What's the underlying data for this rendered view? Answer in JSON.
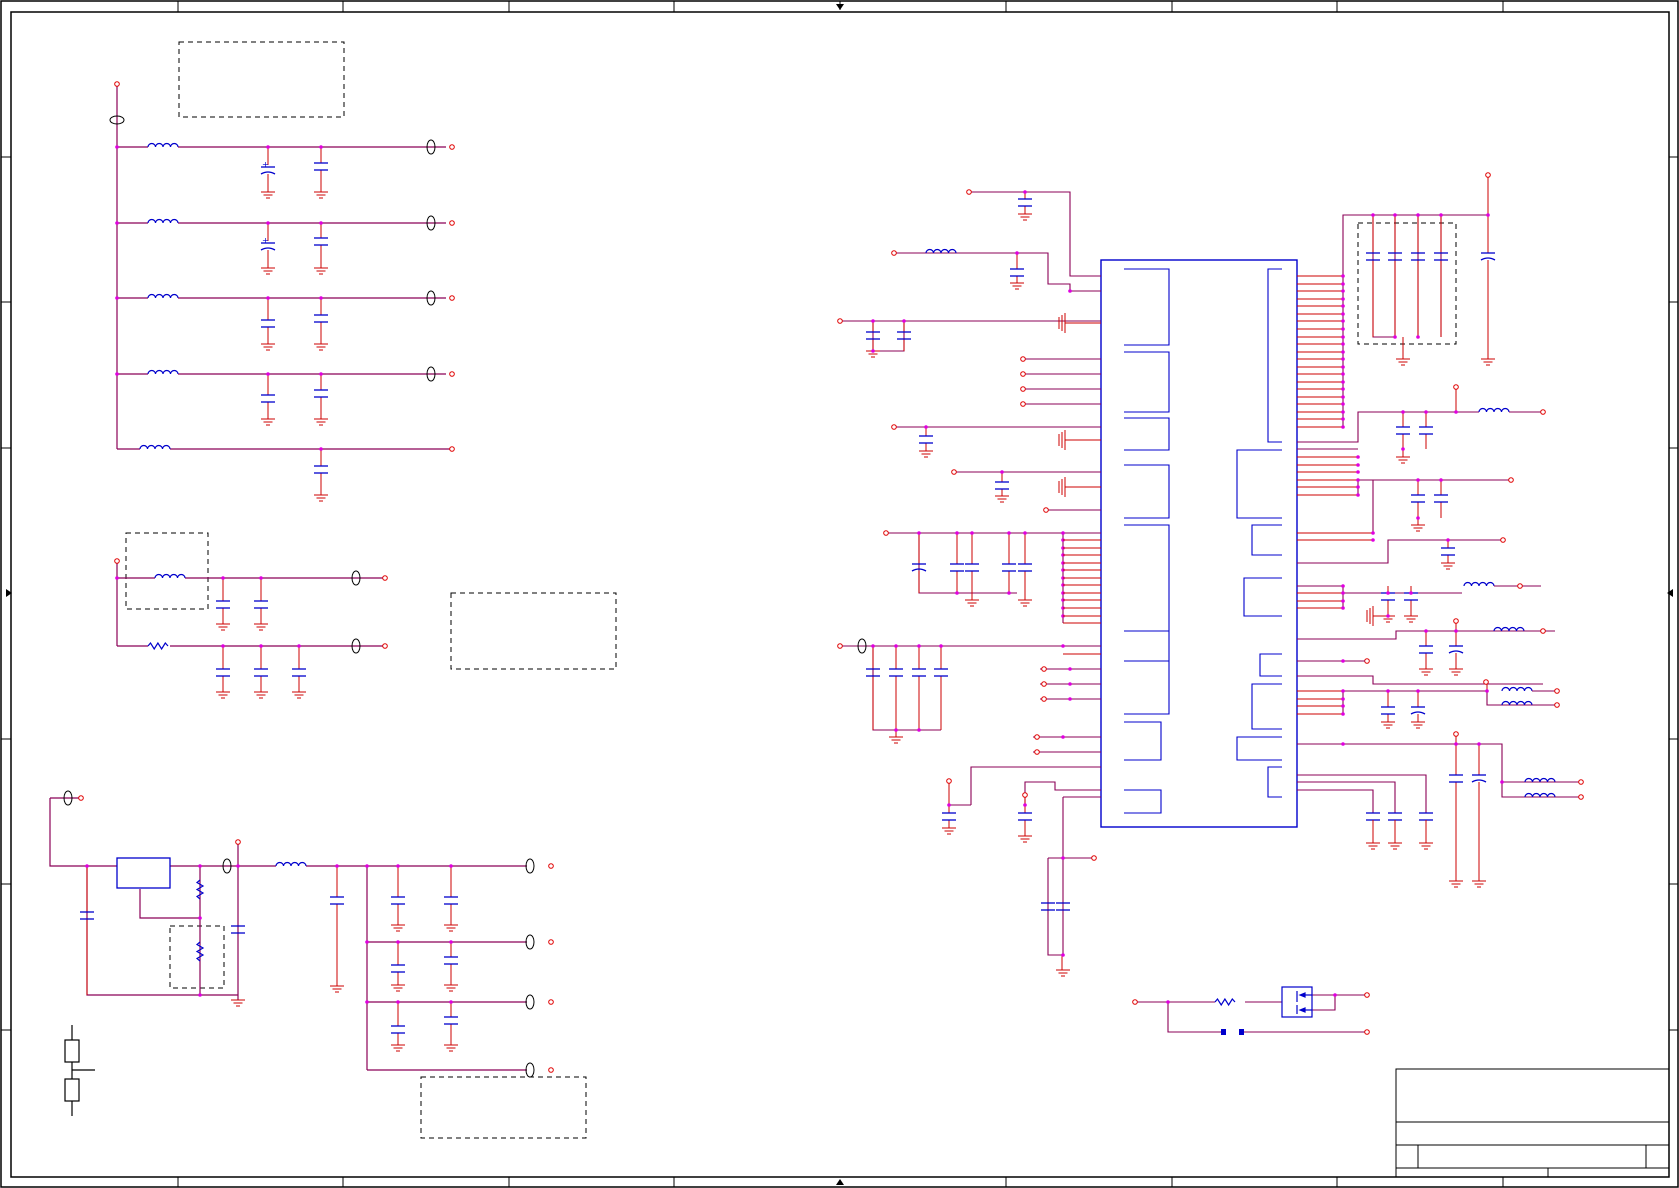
{
  "sheet": {
    "background": "#ffffff",
    "frame_color": "#000000",
    "wire_color": "#cc0000",
    "net_color": "#8b0057",
    "symbol_color": "#0000cc",
    "junction_color": "#e000e0",
    "terminal_color": "#e00000",
    "dashed_box_color": "#000000"
  },
  "title_block": {
    "visible_text": ""
  }
}
